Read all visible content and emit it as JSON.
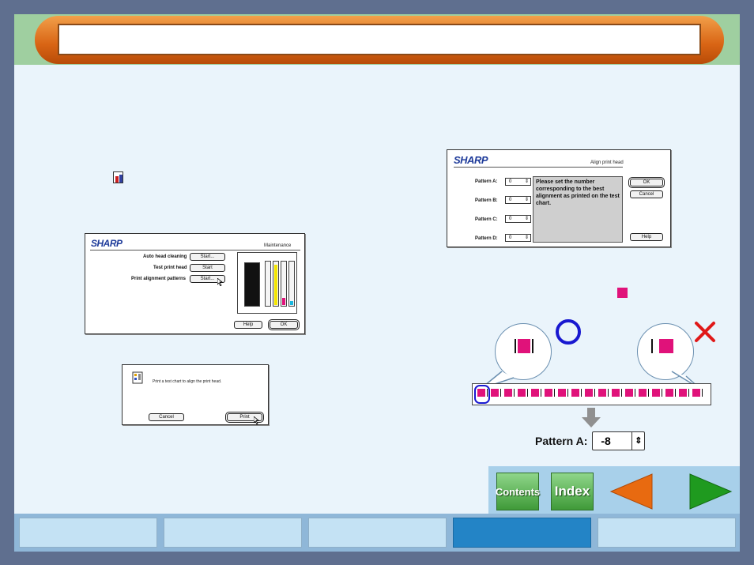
{
  "header": {
    "title": ""
  },
  "maintenance_dialog": {
    "logo": "SHARP",
    "title": "Maintenance",
    "rows": [
      {
        "label": "Auto head cleaning",
        "button": "Start..."
      },
      {
        "label": "Test print head",
        "button": "Start"
      },
      {
        "label": "Print alignment patterns",
        "button": "Start..."
      }
    ],
    "help_label": "Help",
    "ok_label": "OK",
    "ink_colors": [
      "#111111",
      "#e8e8e8",
      "#f4e600",
      "#e0127a",
      "#1ab8e0"
    ]
  },
  "print_dialog": {
    "message": "Print a test chart to align the print head.",
    "cancel_label": "Cancel",
    "print_label": "Print"
  },
  "align_dialog": {
    "logo": "SHARP",
    "title": "Align print head",
    "patterns": [
      {
        "label": "Pattern A:",
        "value": "0"
      },
      {
        "label": "Pattern B:",
        "value": "0"
      },
      {
        "label": "Pattern C:",
        "value": "0"
      },
      {
        "label": "Pattern D:",
        "value": "0"
      }
    ],
    "message": "Please set the number corresponding to the best alignment as printed on the test chart.",
    "ok_label": "OK",
    "cancel_label": "Cancel",
    "help_label": "Help"
  },
  "illustration": {
    "good_marker": "O",
    "bad_marker": "X",
    "pattern_label": "Pattern A:",
    "pattern_value": "-8",
    "colors": {
      "pink": "#e0127a",
      "blue": "#1818d0",
      "red": "#e01818",
      "arrow": "#909090"
    }
  },
  "navigation": {
    "contents_label": "Contents",
    "index_label": "Index",
    "prev_icon": "arrow-left-icon",
    "next_icon": "arrow-right-icon",
    "tabs": [
      "",
      "",
      "",
      "",
      ""
    ],
    "active_tab_index": 3
  }
}
